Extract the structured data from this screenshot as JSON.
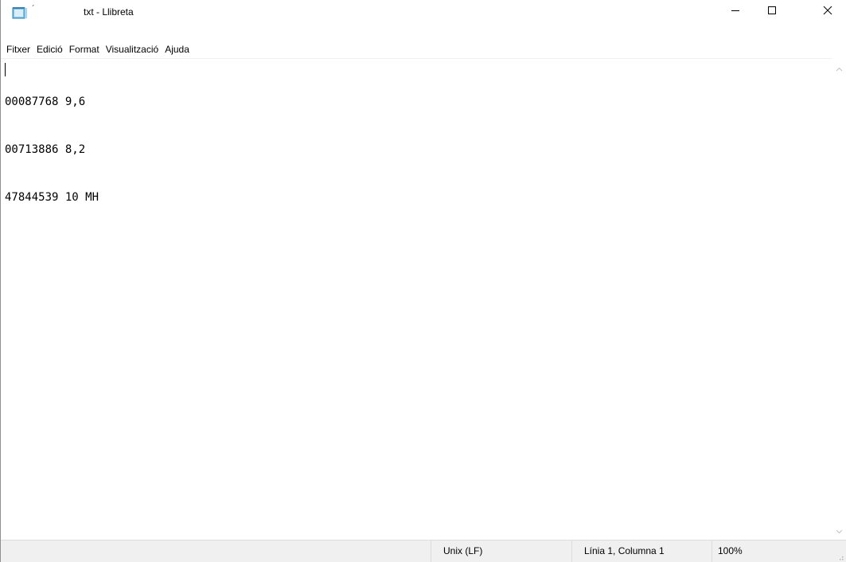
{
  "window": {
    "title_mark": "´",
    "title": "txt - Llibreta",
    "icons": {
      "app": "notepad-icon",
      "minimize": "minimize-icon",
      "maximize": "maximize-icon",
      "close": "close-icon"
    }
  },
  "menu": {
    "items": [
      {
        "label": "Fitxer"
      },
      {
        "label": "Edició"
      },
      {
        "label": "Format"
      },
      {
        "label": "Visualització"
      },
      {
        "label": "Ajuda"
      }
    ]
  },
  "editor": {
    "lines": [
      "00087768 9,6",
      "00713886 8,2",
      "47844539 10 MH"
    ]
  },
  "status": {
    "line_ending": "Unix (LF)",
    "position": "Línia 1, Columna 1",
    "zoom": "100%"
  },
  "colors": {
    "statusbar_bg": "#f0f0f0",
    "close_hover": "#e81123"
  }
}
